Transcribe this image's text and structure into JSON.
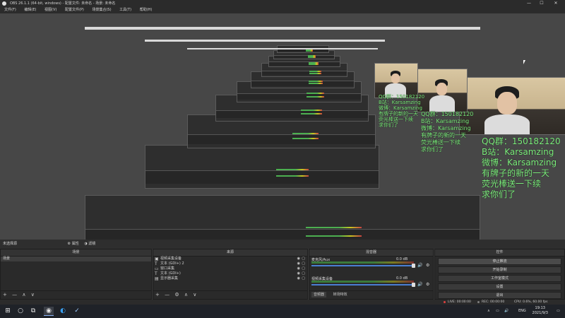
{
  "window": {
    "title": "OBS 26.1.1 (64-bit, windows) - 配置文件: 未命名 - 场景: 未命名",
    "controls": [
      "—",
      "☐",
      "✕"
    ]
  },
  "menu": [
    "文件(F)",
    "编辑(E)",
    "视图(V)",
    "配置文件(P)",
    "场景集合(S)",
    "工具(T)",
    "帮助(H)"
  ],
  "overlay": {
    "lines": [
      "QQ群：150182120",
      "B站：Karsamzing",
      "微博：Karsamzing",
      "有牌子的新的一天",
      "荧光棒送一下续",
      "求你们了"
    ]
  },
  "scene_bar": {
    "label": "未选择源",
    "properties": "属性",
    "filters": "滤镜"
  },
  "scenes": {
    "title": "场景",
    "items": [
      "场景"
    ],
    "tools": [
      "+",
      "—",
      "∧",
      "∨"
    ]
  },
  "sources": {
    "title": "来源",
    "items": [
      {
        "icon": "camera-icon",
        "label": "视频采集设备"
      },
      {
        "icon": "text-icon",
        "label": "文本 (GDI+) 2"
      },
      {
        "icon": "window-icon",
        "label": "窗口采集"
      },
      {
        "icon": "text-icon",
        "label": "文本 (GDI+)"
      },
      {
        "icon": "monitor-icon",
        "label": "显示器采集"
      }
    ],
    "tools": [
      "+",
      "—",
      "⚙",
      "∧",
      "∨"
    ]
  },
  "mixer": {
    "title": "混音器",
    "tracks": [
      {
        "name": "麦克风/Aux",
        "db": "0.0 dB"
      },
      {
        "name": "视频采集设备",
        "db": "0.0 dB"
      }
    ],
    "tabs": [
      "音频器",
      "转场特效"
    ]
  },
  "controls": {
    "title": "控件",
    "buttons": [
      "停止推流",
      "开始录制",
      "工作室模式",
      "设置",
      "退出"
    ]
  },
  "status": {
    "live": "LIVE: 00:00:00",
    "rec": "REC: 00:00:00",
    "cpu": "CPU: 0.6%, 60.00 fps",
    "indicator_color": "#e04040"
  },
  "taskbar": {
    "tray": [
      "∧",
      "▭",
      "🔊",
      "ENG"
    ],
    "time": "19:13",
    "date": "2021/9/3"
  },
  "colors": {
    "overlay_text": "#7ff07f",
    "selected_button": "#4a4a4a"
  }
}
